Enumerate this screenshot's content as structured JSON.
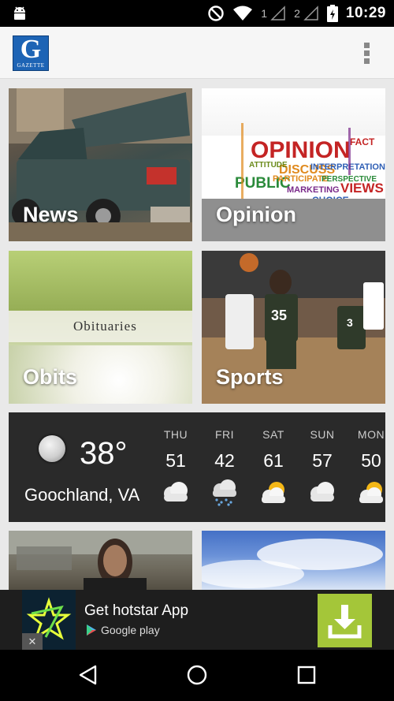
{
  "status_bar": {
    "sim1": "1",
    "sim2": "2",
    "time": "10:29",
    "icons": [
      "android-icon",
      "do-not-disturb-icon",
      "wifi-icon",
      "signal-icon",
      "battery-icon"
    ]
  },
  "app_bar": {
    "logo_letter": "G",
    "logo_word": "GAZETTE",
    "menu_icon": "more-vert-icon"
  },
  "tiles": {
    "news": "News",
    "opinion": "Opinion",
    "obits": "Obits",
    "obits_banner": "Obituaries",
    "sports": "Sports"
  },
  "opinion_words": {
    "main": "OPINION",
    "w1": "DISCUSS",
    "w2": "PUBLIC",
    "w3": "INTERPRETATION",
    "w4": "VIEWS",
    "w5": "MARKETING",
    "w6": "PARTICIPATE",
    "w7": "PERSPECTIVE",
    "w8": "CHOICE",
    "w9": "ATTITUDE",
    "w10": "FACT"
  },
  "weather": {
    "current_temp": "38°",
    "location": "Goochland, VA",
    "current_icon": "moon-icon",
    "forecast": [
      {
        "day": "THU",
        "temp": "51",
        "icon": "cloudy-icon"
      },
      {
        "day": "FRI",
        "temp": "42",
        "icon": "rain-icon"
      },
      {
        "day": "SAT",
        "temp": "61",
        "icon": "partly-sunny-icon"
      },
      {
        "day": "SUN",
        "temp": "57",
        "icon": "cloudy-icon"
      },
      {
        "day": "MON",
        "temp": "50",
        "icon": "partly-sunny-icon"
      }
    ]
  },
  "ad": {
    "title": "Get hotstar App",
    "store": "Google play",
    "close": "✕",
    "colors": {
      "download_bg": "#a4c639"
    }
  },
  "jerseys": {
    "left": "35",
    "right": "3"
  },
  "nav": {
    "back": "back-icon",
    "home": "home-icon",
    "recents": "recents-icon"
  }
}
